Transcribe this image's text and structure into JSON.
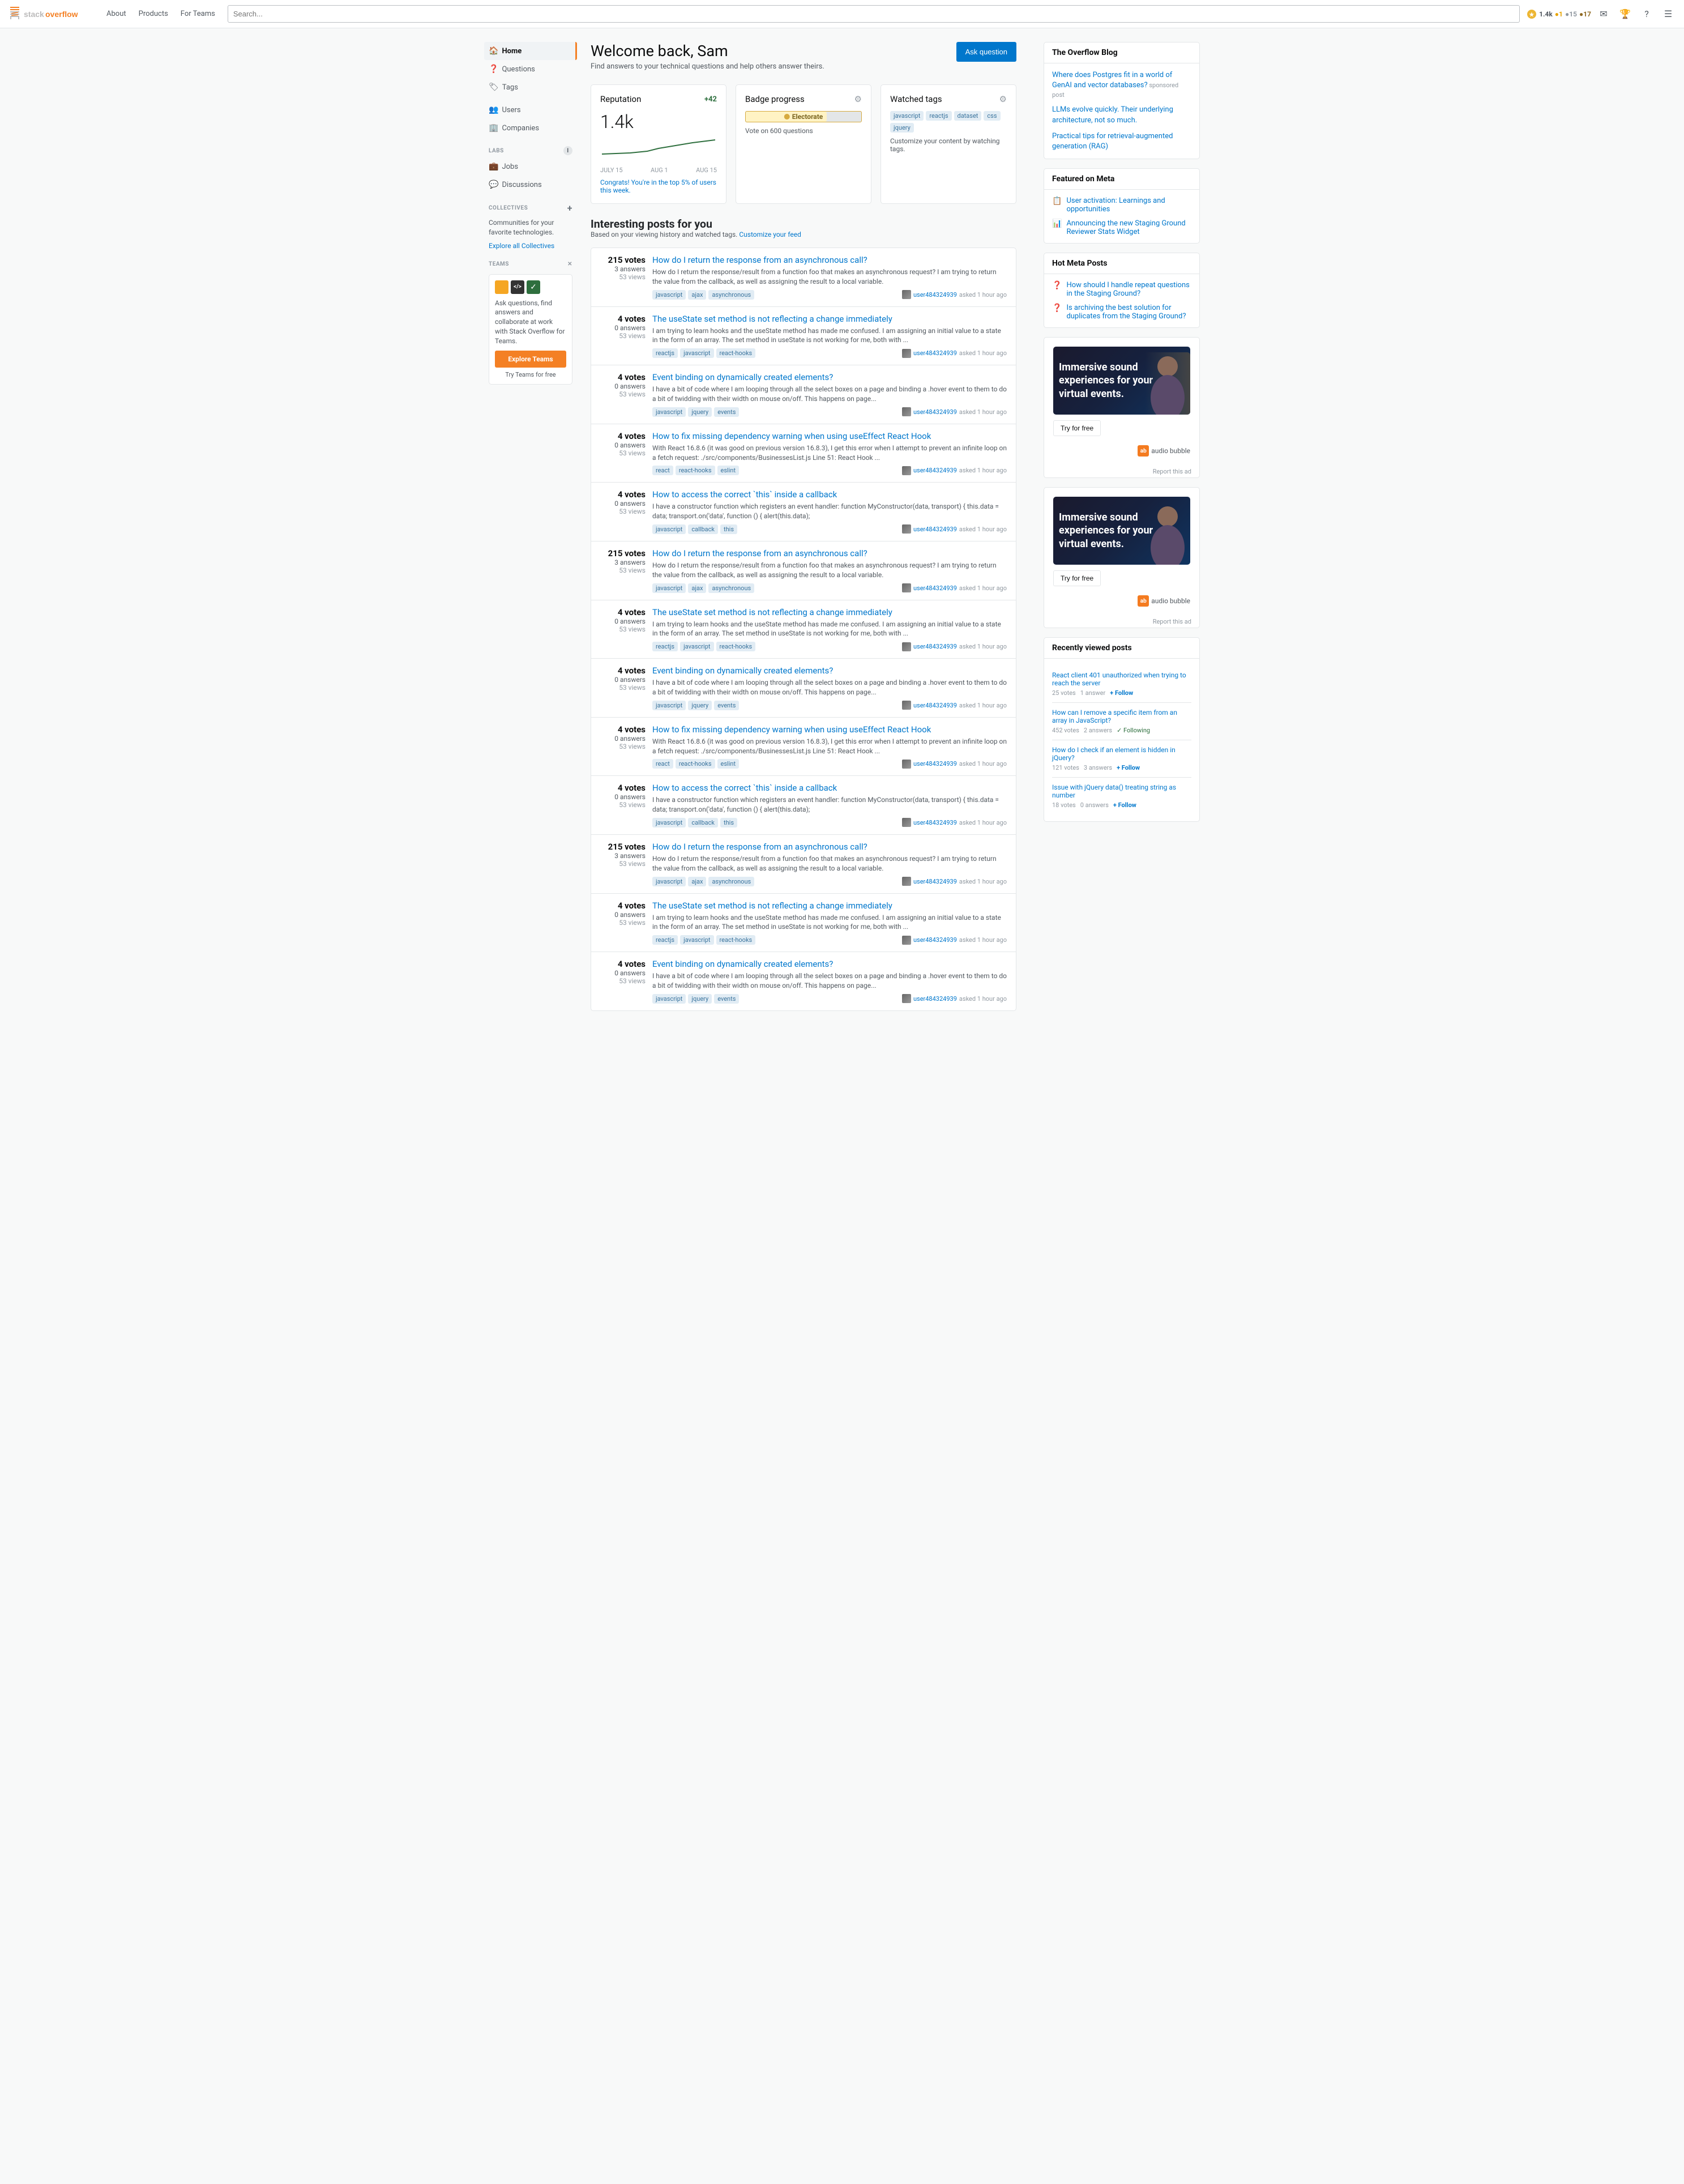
{
  "header": {
    "logo_text": "Stack Overflow",
    "nav": [
      "About",
      "Products",
      "For Teams"
    ],
    "search_placeholder": "Search...",
    "reputation": "1.4k",
    "rep_gold": "1",
    "rep_silver": "15",
    "rep_bronze": "17"
  },
  "sidebar": {
    "nav_items": [
      {
        "label": "Home",
        "icon": "🏠",
        "active": true
      },
      {
        "label": "Questions",
        "icon": "❓",
        "active": false
      },
      {
        "label": "Tags",
        "icon": "🏷️",
        "active": false
      }
    ],
    "nav_items2": [
      {
        "label": "Users",
        "icon": "👥",
        "active": false
      },
      {
        "label": "Companies",
        "icon": "🏢",
        "active": false
      }
    ],
    "labs_label": "LABS",
    "labs_items": [
      {
        "label": "Jobs",
        "icon": "💼"
      },
      {
        "label": "Discussions",
        "icon": "💬"
      }
    ],
    "collectives_label": "COLLECTIVES",
    "collectives_sub": "Communities for your favorite technologies.",
    "explore_link": "Explore all Collectives",
    "teams_label": "TEAMS",
    "teams_description": "Ask questions, find answers and collaborate at work with Stack Overflow for Teams.",
    "explore_teams_btn": "Explore Teams",
    "try_free": "Try Teams for free"
  },
  "welcome": {
    "greeting": "Welcome back, Sam",
    "subtitle": "Find answers to your technical questions and help others answer theirs.",
    "ask_button": "Ask question"
  },
  "reputation_card": {
    "title": "Reputation",
    "change": "+42",
    "value": "1.4k",
    "label_july15": "JULY 15",
    "label_aug1": "AUG 1",
    "label_aug15": "AUG 15",
    "congrats_prefix": "Congrats! You're in the ",
    "congrats_pct": "top 5%",
    "congrats_suffix": " of users this week."
  },
  "badge_card": {
    "title": "Badge progress",
    "badge_name": "Electorate",
    "badge_sub": "Vote on 600 questions",
    "progress_pct": 70
  },
  "watched_tags": {
    "title": "Watched tags",
    "tags": [
      "javascript",
      "reactjs",
      "dataset",
      "css",
      "jquery"
    ],
    "customize": "Customize your content by watching tags."
  },
  "interesting_posts": {
    "title": "Interesting posts for you",
    "subtitle": "Based on your viewing history and watched tags.",
    "customize_link": "Customize your feed",
    "questions": [
      {
        "votes": "215",
        "answers": "3 answers",
        "views": "53 views",
        "title": "How do I return the response from an asynchronous call?",
        "excerpt": "How do I return the response/result from a function foo that makes an asynchronous request? I am trying to return the value from the callback, as well as assigning the result to a local variable.",
        "tags": [
          "javascript",
          "ajax",
          "asynchronous"
        ],
        "user": "user484324939",
        "time": "asked 1 hour ago"
      },
      {
        "votes": "4",
        "answers": "0 answers",
        "views": "53 views",
        "title": "The useState set method is not reflecting a change immediately",
        "excerpt": "I am trying to learn hooks and the useState method has made me confused. I am assigning an initial value to a state in the form of an array. The set method in useState is not working for me, both with ...",
        "tags": [
          "reactjs",
          "javascript",
          "react-hooks"
        ],
        "user": "user484324939",
        "time": "asked 1 hour ago"
      },
      {
        "votes": "4",
        "answers": "0 answers",
        "views": "53 views",
        "title": "Event binding on dynamically created elements?",
        "excerpt": "I have a bit of code where I am looping through all the select boxes on a page and binding a .hover event to them to do a bit of twidding with their width on mouse on/off. This happens on page...",
        "tags": [
          "javascript",
          "jquery",
          "events"
        ],
        "user": "user484324939",
        "time": "asked 1 hour ago"
      },
      {
        "votes": "4",
        "answers": "0 answers",
        "views": "53 views",
        "title": "How to fix missing dependency warning when using useEffect React Hook",
        "excerpt": "With React 16.8.6 (it was good on previous version 16.8.3), I get this error when I attempt to prevent an infinite loop on a fetch request: ./src/components/BusinessesList.js Line 51: React Hook ...",
        "tags": [
          "react",
          "react-hooks",
          "eslint"
        ],
        "user": "user484324939",
        "time": "asked 1 hour ago"
      },
      {
        "votes": "4",
        "answers": "0 answers",
        "views": "53 views",
        "title": "How to access the correct `this` inside a callback",
        "excerpt": "I have a constructor function which registers an event handler: function MyConstructor(data, transport) { this.data = data; transport.on('data', function () { alert(this.data);",
        "tags": [
          "javascript",
          "callback",
          "this"
        ],
        "user": "user484324939",
        "time": "asked 1 hour ago"
      },
      {
        "votes": "215",
        "answers": "3 answers",
        "views": "53 views",
        "title": "How do I return the response from an asynchronous call?",
        "excerpt": "How do I return the response/result from a function foo that makes an asynchronous request? I am trying to return the value from the callback, as well as assigning the result to a local variable.",
        "tags": [
          "javascript",
          "ajax",
          "asynchronous"
        ],
        "user": "user484324939",
        "time": "asked 1 hour ago"
      },
      {
        "votes": "4",
        "answers": "0 answers",
        "views": "53 views",
        "title": "The useState set method is not reflecting a change immediately",
        "excerpt": "I am trying to learn hooks and the useState method has made me confused. I am assigning an initial value to a state in the form of an array. The set method in useState is not working for me, both with ...",
        "tags": [
          "reactjs",
          "javascript",
          "react-hooks"
        ],
        "user": "user484324939",
        "time": "asked 1 hour ago"
      },
      {
        "votes": "4",
        "answers": "0 answers",
        "views": "53 views",
        "title": "Event binding on dynamically created elements?",
        "excerpt": "I have a bit of code where I am looping through all the select boxes on a page and binding a .hover event to them to do a bit of twidding with their width on mouse on/off. This happens on page...",
        "tags": [
          "javascript",
          "jquery",
          "events"
        ],
        "user": "user484324939",
        "time": "asked 1 hour ago"
      },
      {
        "votes": "4",
        "answers": "0 answers",
        "views": "53 views",
        "title": "How to fix missing dependency warning when using useEffect React Hook",
        "excerpt": "With React 16.8.6 (it was good on previous version 16.8.3), I get this error when I attempt to prevent an infinite loop on a fetch request: ./src/components/BusinessesList.js Line 51: React Hook ...",
        "tags": [
          "react",
          "react-hooks",
          "eslint"
        ],
        "user": "user484324939",
        "time": "asked 1 hour ago"
      },
      {
        "votes": "4",
        "answers": "0 answers",
        "views": "53 views",
        "title": "How to access the correct `this` inside a callback",
        "excerpt": "I have a constructor function which registers an event handler: function MyConstructor(data, transport) { this.data = data; transport.on('data', function () { alert(this.data);",
        "tags": [
          "javascript",
          "callback",
          "this"
        ],
        "user": "user484324939",
        "time": "asked 1 hour ago"
      },
      {
        "votes": "215",
        "answers": "3 answers",
        "views": "53 views",
        "title": "How do I return the response from an asynchronous call?",
        "excerpt": "How do I return the response/result from a function foo that makes an asynchronous request? I am trying to return the value from the callback, as well as assigning the result to a local variable.",
        "tags": [
          "javascript",
          "ajax",
          "asynchronous"
        ],
        "user": "user484324939",
        "time": "asked 1 hour ago"
      },
      {
        "votes": "4",
        "answers": "0 answers",
        "views": "53 views",
        "title": "The useState set method is not reflecting a change immediately",
        "excerpt": "I am trying to learn hooks and the useState method has made me confused. I am assigning an initial value to a state in the form of an array. The set method in useState is not working for me, both with ...",
        "tags": [
          "reactjs",
          "javascript",
          "react-hooks"
        ],
        "user": "user484324939",
        "time": "asked 1 hour ago"
      },
      {
        "votes": "4",
        "answers": "0 answers",
        "views": "53 views",
        "title": "Event binding on dynamically created elements?",
        "excerpt": "I have a bit of code where I am looping through all the select boxes on a page and binding a .hover event to them to do a bit of twidding with their width on mouse on/off. This happens on page...",
        "tags": [
          "javascript",
          "jquery",
          "events"
        ],
        "user": "user484324939",
        "time": "asked 1 hour ago"
      }
    ]
  },
  "overflow_blog": {
    "title": "The Overflow Blog",
    "posts": [
      {
        "text": "Where does Postgres fit in a world of GenAI and vector databases?",
        "sponsored": true
      },
      {
        "text": "LLMs evolve quickly. Their underlying architecture, not so much.",
        "sponsored": false
      },
      {
        "text": "Practical tips for retrieval-augmented generation (RAG)",
        "sponsored": false
      }
    ]
  },
  "featured_meta": {
    "title": "Featured on Meta",
    "posts": [
      {
        "icon": "📋",
        "text": "User activation: Learnings and opportunities"
      },
      {
        "icon": "📊",
        "text": "Announcing the new Staging Ground Reviewer Stats Widget"
      }
    ]
  },
  "hot_meta": {
    "title": "Hot Meta Posts",
    "posts": [
      {
        "icon": "❓",
        "text": "How should I handle repeat questions in the Staging Ground?"
      },
      {
        "icon": "❓",
        "text": "Is archiving the best solution for duplicates from the Staging Ground?"
      }
    ]
  },
  "ad1": {
    "headline": "Immersive sound experiences for your virtual events.",
    "btn_label": "Try for free",
    "brand": "audio bubble"
  },
  "ad2": {
    "headline": "Immersive sound experiences for your virtual events.",
    "btn_label": "Try for free",
    "brand": "audio bubble"
  },
  "recently_viewed": {
    "title": "Recently viewed posts",
    "posts": [
      {
        "text": "React client 401 unauthorized when trying to reach the server",
        "votes": "25 votes",
        "answers": "1 answer",
        "action": "+ Follow"
      },
      {
        "text": "How can I remove a specific item from an array in JavaScript?",
        "votes": "452 votes",
        "answers": "2 answers",
        "action": "✓ Following"
      },
      {
        "text": "How do I check if an element is hidden in jQuery?",
        "votes": "121 votes",
        "answers": "3 answers",
        "action": "+ Follow"
      },
      {
        "text": "Issue with jQuery data() treating string as number",
        "votes": "18 votes",
        "answers": "0 answers",
        "action": "+ Follow"
      }
    ]
  }
}
